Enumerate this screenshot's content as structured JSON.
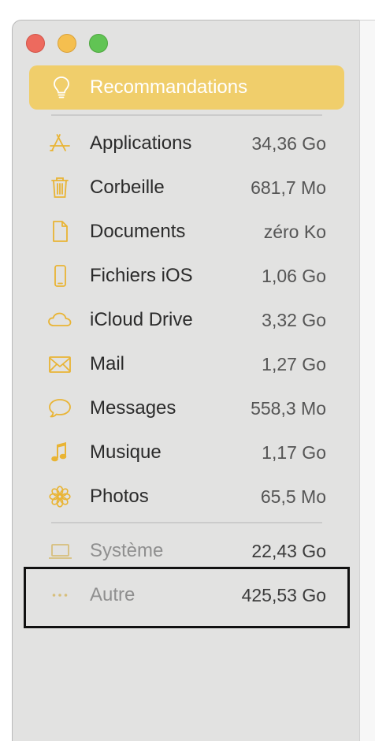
{
  "colors": {
    "accent": "#f0ce6b",
    "icon": "#e9b434",
    "icon_dim": "#d7bf7c",
    "sidebar_bg": "#e2e2e1"
  },
  "sidebar": {
    "selected": {
      "label": "Recommandations",
      "icon": "lightbulb-icon"
    },
    "items": [
      {
        "label": "Applications",
        "size": "34,36 Go",
        "icon": "app-store-icon"
      },
      {
        "label": "Corbeille",
        "size": "681,7 Mo",
        "icon": "trash-icon"
      },
      {
        "label": "Documents",
        "size": "zéro Ko",
        "icon": "document-icon"
      },
      {
        "label": "Fichiers iOS",
        "size": "1,06 Go",
        "icon": "iphone-icon"
      },
      {
        "label": "iCloud Drive",
        "size": "3,32 Go",
        "icon": "cloud-icon"
      },
      {
        "label": "Mail",
        "size": "1,27 Go",
        "icon": "envelope-icon"
      },
      {
        "label": "Messages",
        "size": "558,3 Mo",
        "icon": "speech-bubble-icon"
      },
      {
        "label": "Musique",
        "size": "1,17 Go",
        "icon": "music-note-icon"
      },
      {
        "label": "Photos",
        "size": "65,5 Mo",
        "icon": "photos-flower-icon"
      }
    ],
    "system_items": [
      {
        "label": "Système",
        "size": "22,43 Go",
        "icon": "laptop-icon"
      },
      {
        "label": "Autre",
        "size": "425,53 Go",
        "icon": "ellipsis-icon"
      }
    ]
  }
}
